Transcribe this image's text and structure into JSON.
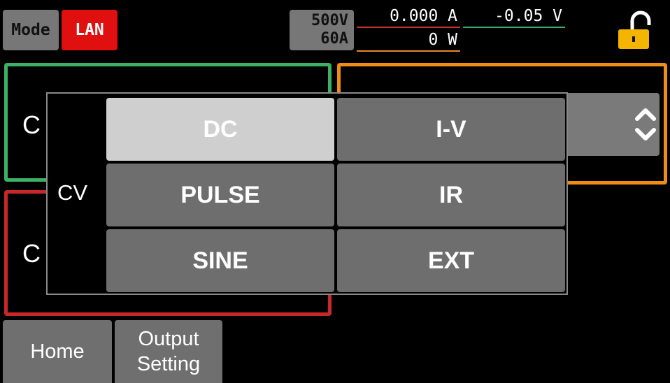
{
  "topbar": {
    "mode_label": "Mode",
    "lan_label": "LAN",
    "rating_voltage": "500V",
    "rating_current": "60A",
    "current_value": "0.000 A",
    "voltage_value": "-0.05 V",
    "power_value": "0 W"
  },
  "panels": {
    "green_letter": "C",
    "red_letter": "C"
  },
  "nav": {
    "home_label": "Home",
    "output_line1": "Output",
    "output_line2": "Setting"
  },
  "popup": {
    "mode_label": "CV",
    "options": [
      {
        "label": "DC",
        "selected": true
      },
      {
        "label": "I-V",
        "selected": false
      },
      {
        "label": "PULSE",
        "selected": false
      },
      {
        "label": "IR",
        "selected": false
      },
      {
        "label": "SINE",
        "selected": false
      },
      {
        "label": "EXT",
        "selected": false
      }
    ]
  },
  "colors": {
    "lan_red": "#e01010",
    "panel_green": "#3cb064",
    "panel_orange": "#f08c18",
    "panel_red": "#c82828",
    "lock_yellow": "#f5b400"
  },
  "icons": {
    "lock": "unlocked-padlock-icon",
    "spinner": "chevron-up-down-icon"
  }
}
